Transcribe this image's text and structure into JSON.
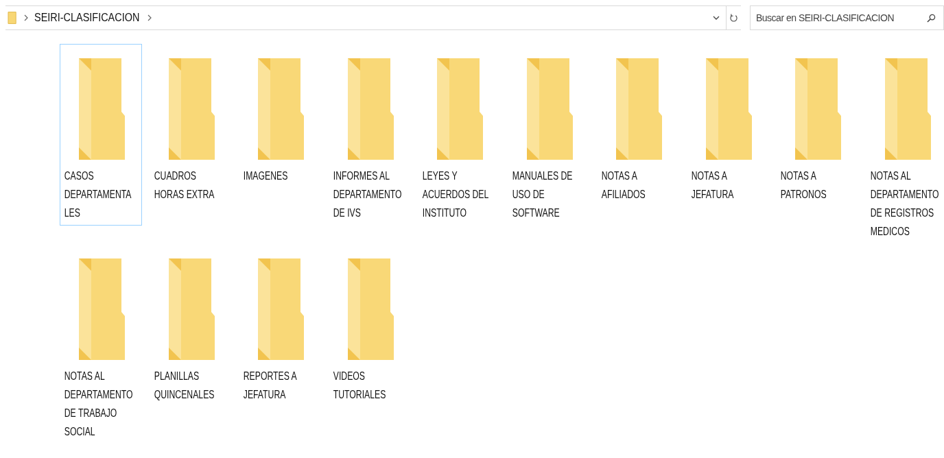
{
  "address_bar": {
    "path": [
      {
        "label": "SEIRI-CLASIFICACION"
      }
    ]
  },
  "search": {
    "placeholder": "Buscar en SEIRI-CLASIFICACION"
  },
  "folders": [
    {
      "lines": [
        "CASOS",
        "DEPARTAMENTA",
        "LES"
      ],
      "selected": true
    },
    {
      "lines": [
        "CUADROS",
        "HORAS EXTRA"
      ],
      "selected": false
    },
    {
      "lines": [
        "IMAGENES"
      ],
      "selected": false
    },
    {
      "lines": [
        "INFORMES AL",
        "DEPARTAMENTO",
        "DE IVS"
      ],
      "selected": false
    },
    {
      "lines": [
        "LEYES Y",
        "ACUERDOS DEL",
        "INSTITUTO"
      ],
      "selected": false
    },
    {
      "lines": [
        "MANUALES DE",
        "USO DE",
        "SOFTWARE"
      ],
      "selected": false
    },
    {
      "lines": [
        "NOTAS A",
        "AFILIADOS"
      ],
      "selected": false
    },
    {
      "lines": [
        "NOTAS A",
        "JEFATURA"
      ],
      "selected": false
    },
    {
      "lines": [
        "NOTAS A",
        "PATRONOS"
      ],
      "selected": false
    },
    {
      "lines": [
        "NOTAS AL",
        "DEPARTAMENTO",
        "DE REGISTROS",
        "MEDICOS"
      ],
      "selected": false
    },
    {
      "lines": [
        "NOTAS AL",
        "DEPARTAMENTO",
        "DE TRABAJO",
        "SOCIAL"
      ],
      "selected": false
    },
    {
      "lines": [
        "PLANILLAS",
        "QUINCENALES"
      ],
      "selected": false
    },
    {
      "lines": [
        "REPORTES A",
        "JEFATURA"
      ],
      "selected": false
    },
    {
      "lines": [
        "VIDEOS",
        "TUTORIALES"
      ],
      "selected": false
    }
  ]
}
